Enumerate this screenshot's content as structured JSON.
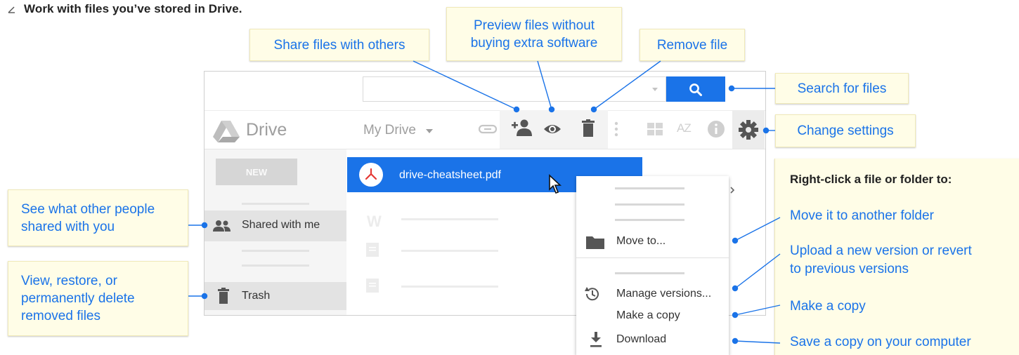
{
  "heading": {
    "text": "Work with files you’ve stored in Drive."
  },
  "callouts": {
    "share": "Share files with others",
    "preview_line1": "Preview files without",
    "preview_line2": "buying extra software",
    "remove": "Remove file",
    "search": "Search for files",
    "settings": "Change settings",
    "shared_line1": "See what other people",
    "shared_line2": "shared with you",
    "trash_line1": "View, restore, or",
    "trash_line2": "permanently delete",
    "trash_line3": "removed files"
  },
  "right_panel": {
    "title": "Right-click a file or folder to:",
    "move": "Move it to another folder",
    "upload_line1": "Upload a new version or revert",
    "upload_line2": "to previous versions",
    "copy": "Make a copy",
    "save": "Save a copy on your computer"
  },
  "drive": {
    "logo_label": "Drive",
    "breadcrumb": "My Drive",
    "new_button": "NEW",
    "sidebar_shared": "Shared with me",
    "sidebar_trash": "Trash",
    "selected_file": "drive-cheatsheet.pdf",
    "doc_placeholder_letter": "W",
    "sort_icon_text": "AZ"
  },
  "context_menu": {
    "move_to": "Move to...",
    "manage_versions": "Manage versions...",
    "make_copy": "Make a copy",
    "download": "Download"
  },
  "colors": {
    "accent": "#1a73e8",
    "callout_bg": "#fffde7"
  },
  "icons": [
    "search-icon",
    "share-person-icon",
    "eye-icon",
    "trash-icon",
    "link-icon",
    "more-vert-icon",
    "grid-icon",
    "sort-az-icon",
    "info-icon",
    "gear-icon",
    "drive-logo-icon",
    "people-icon",
    "pdf-icon",
    "cursor-icon",
    "folder-icon",
    "history-icon",
    "download-icon",
    "chevron-right-icon"
  ]
}
